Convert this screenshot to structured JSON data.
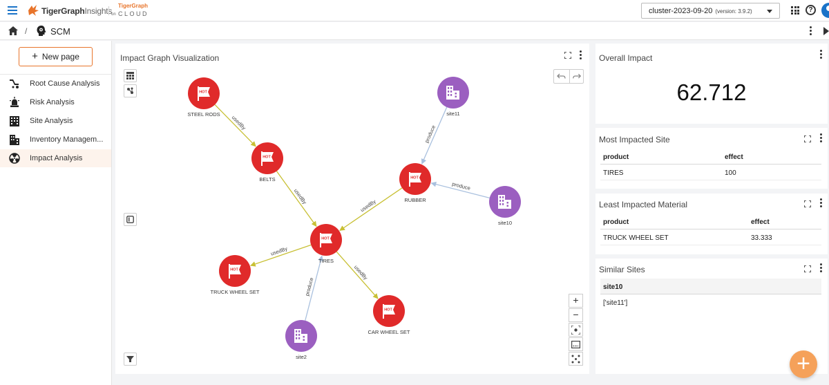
{
  "header": {
    "brand_main": "TigerGraph",
    "brand_sub": "Insights",
    "cloud_top": "TigerGraph",
    "cloud_on": "on",
    "cloud_word": "CLOUD",
    "cluster_name": "cluster-2023-09-20",
    "cluster_version": "(version: 3.9.2)",
    "help_glyph": "?"
  },
  "breadcrumb": {
    "separator": "/",
    "app_name": "SCM"
  },
  "sidebar": {
    "new_page_plus": "+",
    "new_page_label": "New page",
    "items": [
      {
        "label": "Root Cause Analysis",
        "icon": "root-cause-icon"
      },
      {
        "label": "Risk Analysis",
        "icon": "alarm-icon"
      },
      {
        "label": "Site Analysis",
        "icon": "building-icon"
      },
      {
        "label": "Inventory Managem...",
        "icon": "warehouse-icon"
      },
      {
        "label": "Impact Analysis",
        "icon": "radiation-icon",
        "active": true
      }
    ]
  },
  "graph": {
    "title": "Impact Graph Visualization",
    "node_badge": "HOT",
    "nodes": [
      {
        "id": "steel_rods",
        "label": "STEEL RODS",
        "type": "product"
      },
      {
        "id": "belts",
        "label": "BELTS",
        "type": "product"
      },
      {
        "id": "rubber",
        "label": "RUBBER",
        "type": "product"
      },
      {
        "id": "tires",
        "label": "TIRES",
        "type": "product"
      },
      {
        "id": "truck_wheel_set",
        "label": "TRUCK WHEEL SET",
        "type": "product"
      },
      {
        "id": "car_wheel_set",
        "label": "CAR WHEEL SET",
        "type": "product"
      },
      {
        "id": "site11",
        "label": "site11",
        "type": "site"
      },
      {
        "id": "site10",
        "label": "site10",
        "type": "site"
      },
      {
        "id": "site2",
        "label": "site2",
        "type": "site"
      }
    ],
    "edges": [
      {
        "from": "steel_rods",
        "to": "belts",
        "label": "usedBy"
      },
      {
        "from": "belts",
        "to": "tires",
        "label": "usedBy"
      },
      {
        "from": "rubber",
        "to": "tires",
        "label": "usedBy"
      },
      {
        "from": "tires",
        "to": "truck_wheel_set",
        "label": "usedBy"
      },
      {
        "from": "tires",
        "to": "car_wheel_set",
        "label": "usedBy"
      },
      {
        "from": "site11",
        "to": "rubber",
        "label": "produce"
      },
      {
        "from": "site10",
        "to": "rubber",
        "label": "produce"
      },
      {
        "from": "site2",
        "to": "tires",
        "label": "produce"
      }
    ],
    "zoom_in": "+",
    "zoom_out": "−"
  },
  "overall_impact": {
    "title": "Overall Impact",
    "value": "62.712"
  },
  "most_impacted_site": {
    "title": "Most Impacted Site",
    "columns": [
      "product",
      "effect"
    ],
    "rows": [
      [
        "TIRES",
        "100"
      ]
    ]
  },
  "least_impacted_material": {
    "title": "Least Impacted Material",
    "columns": [
      "product",
      "effect"
    ],
    "rows": [
      [
        "TRUCK WHEEL SET",
        "33.333"
      ]
    ]
  },
  "similar_sites": {
    "title": "Similar Sites",
    "column": "site10",
    "value": "['site11']"
  },
  "fab_label": "+",
  "colors": {
    "accent": "#e8742a",
    "product_node": "#e02a2a",
    "site_node": "#9b5fc0",
    "used_by_edge": "#c8c034",
    "produce_edge": "#a9c0de",
    "fab": "#f5a15a",
    "primary": "#1a73c8"
  }
}
